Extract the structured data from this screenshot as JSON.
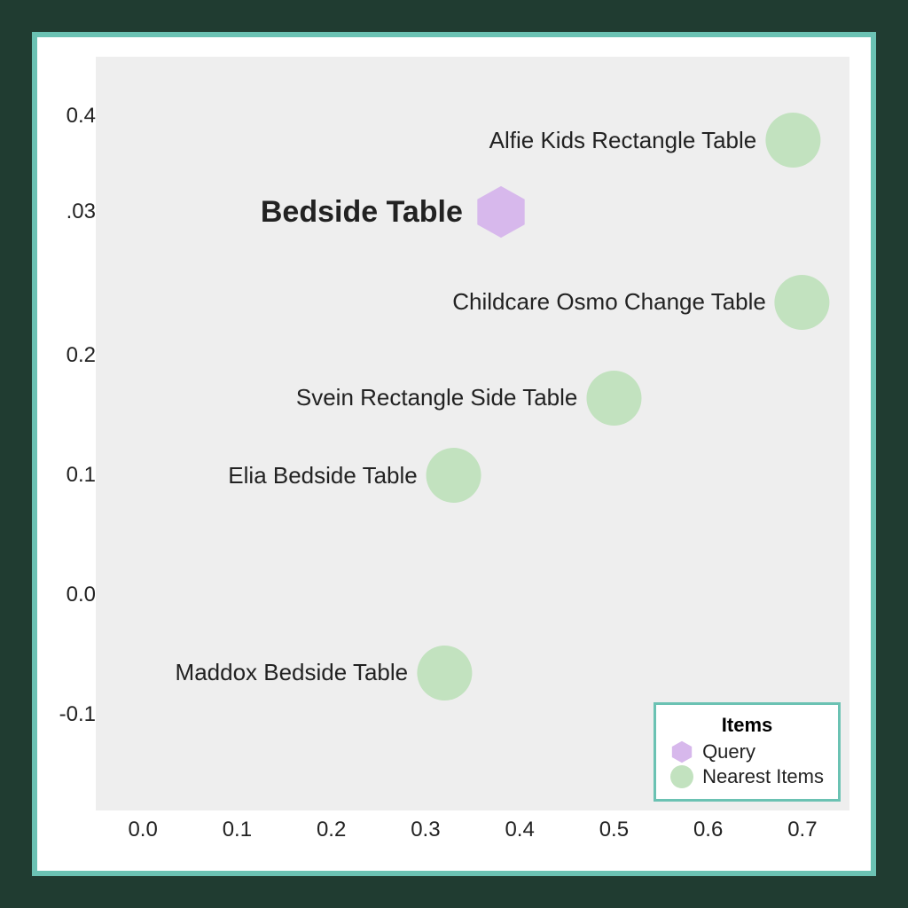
{
  "chart_data": {
    "type": "scatter",
    "xlim": [
      -0.05,
      0.75
    ],
    "ylim": [
      -0.18,
      0.45
    ],
    "xticks": [
      0.0,
      0.1,
      0.2,
      0.3,
      0.4,
      0.5,
      0.6,
      0.7
    ],
    "yticks": [
      -0.1,
      0.0,
      0.1,
      0.2,
      0.03,
      0.4
    ],
    "ytick_labels": [
      "-0.1",
      "0.0",
      "0.1",
      "0.2",
      ".03",
      "0.4"
    ],
    "xtick_labels": [
      "0.0",
      "0.1",
      "0.2",
      "0.3",
      "0.4",
      "0.5",
      "0.6",
      "0.7"
    ],
    "legend": {
      "title": "Items",
      "entries": [
        {
          "name": "Query",
          "shape": "hex",
          "color": "#d7b8ec"
        },
        {
          "name": "Nearest Items",
          "shape": "circle",
          "color": "#c2e2bf"
        }
      ]
    },
    "query": {
      "label": "Bedside Table",
      "x": 0.38,
      "y": 0.32
    },
    "items": [
      {
        "label": "Alfie Kids Rectangle Table",
        "x": 0.69,
        "y": 0.38
      },
      {
        "label": "Childcare Osmo Change Table",
        "x": 0.7,
        "y": 0.245
      },
      {
        "label": "Svein Rectangle Side Table",
        "x": 0.5,
        "y": 0.165
      },
      {
        "label": "Elia Bedside Table",
        "x": 0.33,
        "y": 0.1
      },
      {
        "label": "Maddox Bedside Table",
        "x": 0.32,
        "y": -0.065
      }
    ]
  },
  "colors": {
    "hex": "#d7b8ec",
    "circle": "#c2e2bf",
    "frame": "#6bc2b3"
  }
}
